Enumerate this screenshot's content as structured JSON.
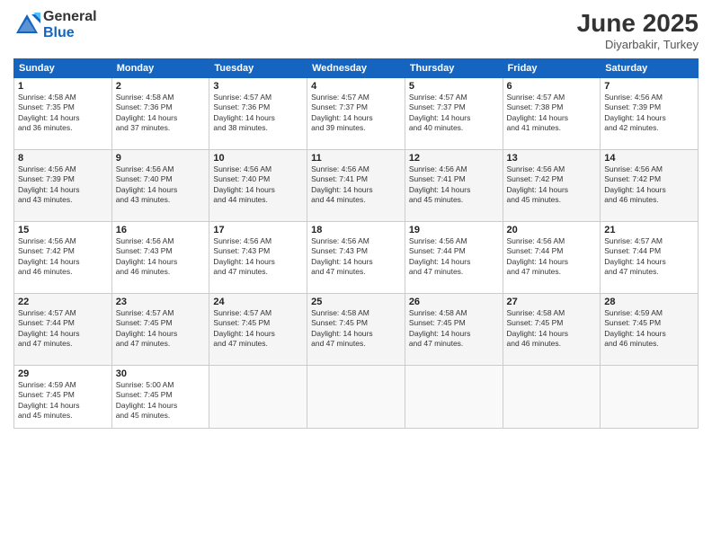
{
  "logo": {
    "general": "General",
    "blue": "Blue"
  },
  "title": "June 2025",
  "subtitle": "Diyarbakir, Turkey",
  "days_header": [
    "Sunday",
    "Monday",
    "Tuesday",
    "Wednesday",
    "Thursday",
    "Friday",
    "Saturday"
  ],
  "weeks": [
    [
      {
        "day": "1",
        "sunrise": "4:58 AM",
        "sunset": "7:35 PM",
        "daylight": "14 hours and 36 minutes."
      },
      {
        "day": "2",
        "sunrise": "4:58 AM",
        "sunset": "7:36 PM",
        "daylight": "14 hours and 37 minutes."
      },
      {
        "day": "3",
        "sunrise": "4:57 AM",
        "sunset": "7:36 PM",
        "daylight": "14 hours and 38 minutes."
      },
      {
        "day": "4",
        "sunrise": "4:57 AM",
        "sunset": "7:37 PM",
        "daylight": "14 hours and 39 minutes."
      },
      {
        "day": "5",
        "sunrise": "4:57 AM",
        "sunset": "7:37 PM",
        "daylight": "14 hours and 40 minutes."
      },
      {
        "day": "6",
        "sunrise": "4:57 AM",
        "sunset": "7:38 PM",
        "daylight": "14 hours and 41 minutes."
      },
      {
        "day": "7",
        "sunrise": "4:56 AM",
        "sunset": "7:39 PM",
        "daylight": "14 hours and 42 minutes."
      }
    ],
    [
      {
        "day": "8",
        "sunrise": "4:56 AM",
        "sunset": "7:39 PM",
        "daylight": "14 hours and 43 minutes."
      },
      {
        "day": "9",
        "sunrise": "4:56 AM",
        "sunset": "7:40 PM",
        "daylight": "14 hours and 43 minutes."
      },
      {
        "day": "10",
        "sunrise": "4:56 AM",
        "sunset": "7:40 PM",
        "daylight": "14 hours and 44 minutes."
      },
      {
        "day": "11",
        "sunrise": "4:56 AM",
        "sunset": "7:41 PM",
        "daylight": "14 hours and 44 minutes."
      },
      {
        "day": "12",
        "sunrise": "4:56 AM",
        "sunset": "7:41 PM",
        "daylight": "14 hours and 45 minutes."
      },
      {
        "day": "13",
        "sunrise": "4:56 AM",
        "sunset": "7:42 PM",
        "daylight": "14 hours and 45 minutes."
      },
      {
        "day": "14",
        "sunrise": "4:56 AM",
        "sunset": "7:42 PM",
        "daylight": "14 hours and 46 minutes."
      }
    ],
    [
      {
        "day": "15",
        "sunrise": "4:56 AM",
        "sunset": "7:42 PM",
        "daylight": "14 hours and 46 minutes."
      },
      {
        "day": "16",
        "sunrise": "4:56 AM",
        "sunset": "7:43 PM",
        "daylight": "14 hours and 46 minutes."
      },
      {
        "day": "17",
        "sunrise": "4:56 AM",
        "sunset": "7:43 PM",
        "daylight": "14 hours and 47 minutes."
      },
      {
        "day": "18",
        "sunrise": "4:56 AM",
        "sunset": "7:43 PM",
        "daylight": "14 hours and 47 minutes."
      },
      {
        "day": "19",
        "sunrise": "4:56 AM",
        "sunset": "7:44 PM",
        "daylight": "14 hours and 47 minutes."
      },
      {
        "day": "20",
        "sunrise": "4:56 AM",
        "sunset": "7:44 PM",
        "daylight": "14 hours and 47 minutes."
      },
      {
        "day": "21",
        "sunrise": "4:57 AM",
        "sunset": "7:44 PM",
        "daylight": "14 hours and 47 minutes."
      }
    ],
    [
      {
        "day": "22",
        "sunrise": "4:57 AM",
        "sunset": "7:44 PM",
        "daylight": "14 hours and 47 minutes."
      },
      {
        "day": "23",
        "sunrise": "4:57 AM",
        "sunset": "7:45 PM",
        "daylight": "14 hours and 47 minutes."
      },
      {
        "day": "24",
        "sunrise": "4:57 AM",
        "sunset": "7:45 PM",
        "daylight": "14 hours and 47 minutes."
      },
      {
        "day": "25",
        "sunrise": "4:58 AM",
        "sunset": "7:45 PM",
        "daylight": "14 hours and 47 minutes."
      },
      {
        "day": "26",
        "sunrise": "4:58 AM",
        "sunset": "7:45 PM",
        "daylight": "14 hours and 47 minutes."
      },
      {
        "day": "27",
        "sunrise": "4:58 AM",
        "sunset": "7:45 PM",
        "daylight": "14 hours and 46 minutes."
      },
      {
        "day": "28",
        "sunrise": "4:59 AM",
        "sunset": "7:45 PM",
        "daylight": "14 hours and 46 minutes."
      }
    ],
    [
      {
        "day": "29",
        "sunrise": "4:59 AM",
        "sunset": "7:45 PM",
        "daylight": "14 hours and 45 minutes."
      },
      {
        "day": "30",
        "sunrise": "5:00 AM",
        "sunset": "7:45 PM",
        "daylight": "14 hours and 45 minutes."
      },
      null,
      null,
      null,
      null,
      null
    ]
  ]
}
